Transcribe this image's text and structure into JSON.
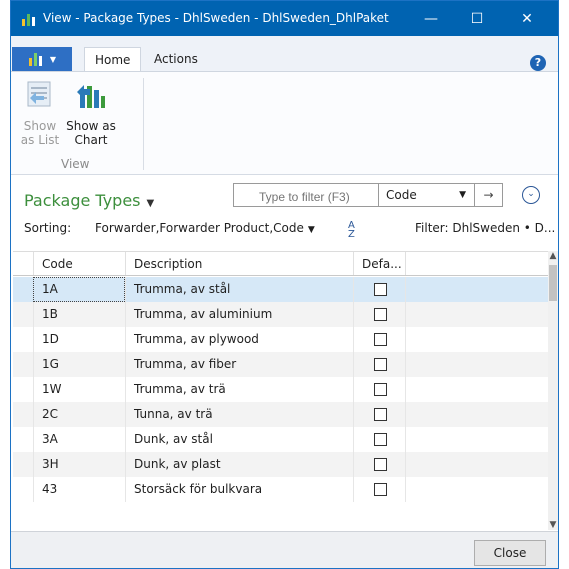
{
  "window": {
    "title": "View - Package Types - DhlSweden - DhlSweden_DhlPaket",
    "minimize_glyph": "—",
    "maximize_glyph": "☐",
    "close_glyph": "✕",
    "accent_color": "#0063b1"
  },
  "ribbon": {
    "tabs": [
      {
        "label": "Home"
      },
      {
        "label": "Actions"
      }
    ],
    "help_glyph": "?",
    "buttons": {
      "show_as_list": "Show as List",
      "show_as_chart": "Show as Chart"
    },
    "group_label": "View"
  },
  "page": {
    "title": "Package Types",
    "title_color": "#3d8f3d",
    "filter_placeholder": "Type to filter (F3)",
    "filter_column": "Code",
    "go_glyph": "→",
    "expand_glyph": "⌄",
    "sorting_label": "Sorting:",
    "sorting_value": "Forwarder,Forwarder Product,Code",
    "filter_text": "Filter: DhlSweden • D..."
  },
  "grid": {
    "columns": [
      "Code",
      "Description",
      "Defa..."
    ],
    "rows": [
      {
        "code": "1A",
        "description": "Trumma, av stål",
        "default": false
      },
      {
        "code": "1B",
        "description": "Trumma, av aluminium",
        "default": false
      },
      {
        "code": "1D",
        "description": "Trumma, av plywood",
        "default": false
      },
      {
        "code": "1G",
        "description": "Trumma, av fiber",
        "default": false
      },
      {
        "code": "1W",
        "description": "Trumma, av trä",
        "default": false
      },
      {
        "code": "2C",
        "description": "Tunna, av trä",
        "default": false
      },
      {
        "code": "3A",
        "description": "Dunk, av stål",
        "default": false
      },
      {
        "code": "3H",
        "description": "Dunk, av plast",
        "default": false
      },
      {
        "code": "43",
        "description": "Storsäck för bulkvara",
        "default": false
      }
    ],
    "selected_row": 0
  },
  "footer": {
    "close_label": "Close"
  }
}
